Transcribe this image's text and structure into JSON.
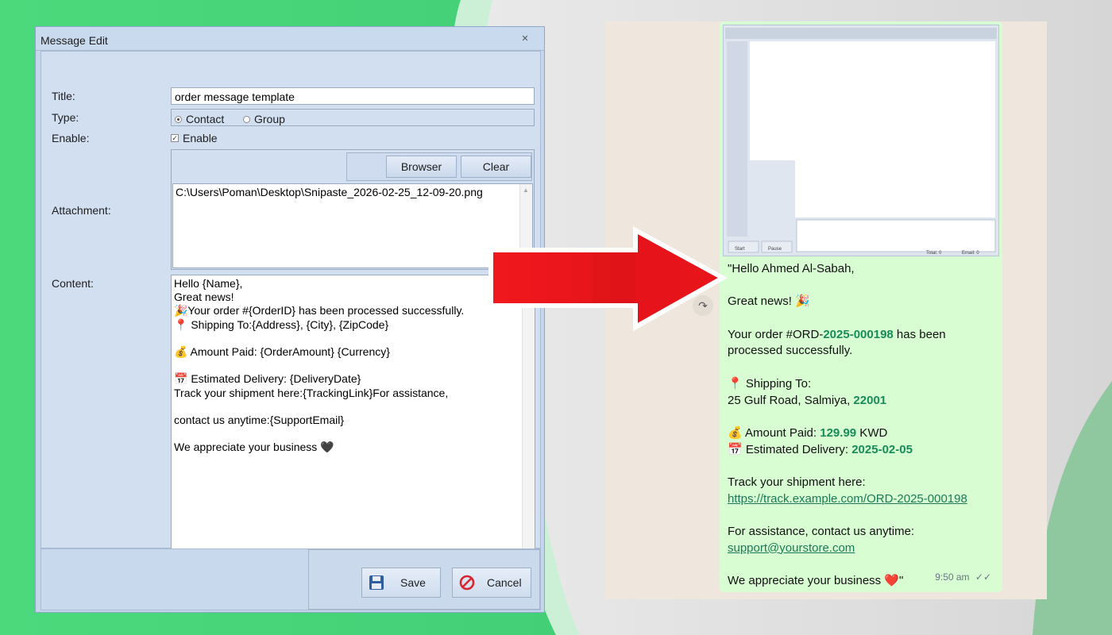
{
  "dialog": {
    "window_title": "Message Edit",
    "close_glyph": "✕",
    "labels": {
      "title": "Title:",
      "type": "Type:",
      "enable": "Enable:",
      "attachment": "Attachment:",
      "content": "Content:"
    },
    "title_value": "order message template",
    "type_options": [
      {
        "label": "Contact",
        "selected": true
      },
      {
        "label": "Group",
        "selected": false
      }
    ],
    "enable_checkbox_label": "Enable",
    "enable_checked": true,
    "attachment_buttons": {
      "browse": "Browser",
      "clear": "Clear"
    },
    "attachment_files": [
      "C:\\Users\\Poman\\Desktop\\Snipaste_2026-02-25_12-09-20.png"
    ],
    "content_lines": [
      "Hello {Name},",
      "Great news!",
      "🎉Your order #{OrderID} has been processed successfully.",
      "📍 Shipping To:{Address}, {City}, {ZipCode}",
      "",
      "💰 Amount Paid: {OrderAmount} {Currency}",
      "",
      "📅 Estimated Delivery: {DeliveryDate}",
      "Track your shipment here:{TrackingLink}For assistance,",
      "",
      "contact us anytime:{SupportEmail}",
      "",
      "We appreciate your business 🖤"
    ],
    "footer_buttons": {
      "save": "Save",
      "cancel": "Cancel"
    },
    "icons": {
      "save": "floppy-disk-icon",
      "cancel": "no-entry-icon"
    }
  },
  "chat": {
    "attachment_preview": {
      "start_label": "Start",
      "pause_label": "Pause",
      "total_label": "Total: 0",
      "email_label": "Email: 0"
    },
    "message": {
      "greeting": "\"Hello Ahmed Al-Sabah,",
      "line_great": "Great news! 🎉",
      "order_prefix": "Your order #ORD-",
      "order_number": "2025-000198",
      "order_suffix": " has been",
      "order_line2": "processed successfully.",
      "shipping_label": "📍 Shipping To:",
      "address_prefix": "25 Gulf Road, Salmiya, ",
      "zip": "22001",
      "amount_prefix": "💰 Amount Paid: ",
      "amount_value": "129.99",
      "amount_suffix": " KWD",
      "delivery_prefix": "📅 Estimated Delivery: ",
      "delivery_date": "2025-02-05",
      "track_label": "Track your shipment here:",
      "track_link": "https://track.example.com/ORD-2025-000198",
      "assist_label": "For assistance, contact us anytime:",
      "support_email": "support@yourstore.com",
      "closing": "We appreciate your business ❤️\""
    },
    "time": "9:50 am",
    "read_ticks": "✓✓",
    "forward_icon": "forward-arrow-icon"
  },
  "colors": {
    "dialog_bg": "#c5d6ec",
    "bubble_bg": "#d9fdd3",
    "chat_bg": "#efe7dd",
    "highlight_green": "#178c58",
    "arrow_red": "#e8141a",
    "background_green": "#4fd97f"
  }
}
